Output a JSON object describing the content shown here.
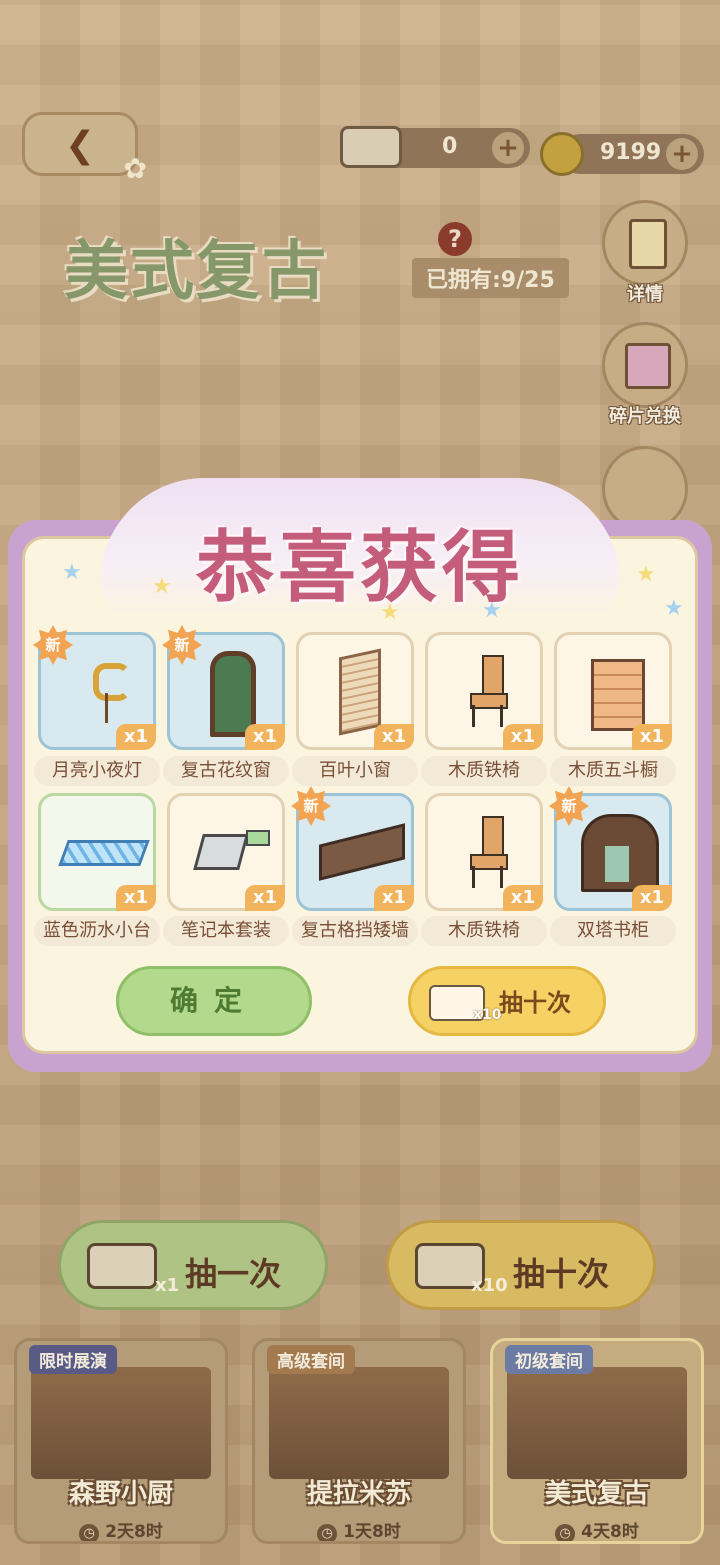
{
  "header": {
    "tickets": "0",
    "coins": "9199",
    "plus": "+"
  },
  "set": {
    "title": "美式复古",
    "help": "?",
    "owned": "已拥有:9/25"
  },
  "side": {
    "details": "详情",
    "exchange": "碎片兑换"
  },
  "modal": {
    "title": "恭喜获得",
    "new_badge": "新",
    "items": [
      {
        "name": "月亮小夜灯",
        "qty": "x1",
        "is_new": true
      },
      {
        "name": "复古花纹窗",
        "qty": "x1",
        "is_new": true
      },
      {
        "name": "百叶小窗",
        "qty": "x1",
        "is_new": false
      },
      {
        "name": "木质铁椅",
        "qty": "x1",
        "is_new": false
      },
      {
        "name": "木质五斗橱",
        "qty": "x1",
        "is_new": false
      },
      {
        "name": "蓝色沥水小台",
        "qty": "x1",
        "is_new": false
      },
      {
        "name": "笔记本套装",
        "qty": "x1",
        "is_new": false
      },
      {
        "name": "复古格挡矮墙",
        "qty": "x1",
        "is_new": true
      },
      {
        "name": "木质铁椅",
        "qty": "x1",
        "is_new": false
      },
      {
        "name": "双塔书柜",
        "qty": "x1",
        "is_new": true
      }
    ],
    "confirm": "确定",
    "draw_ten": "抽十次",
    "draw_ten_count": "x10"
  },
  "draw": {
    "one_label": "抽一次",
    "one_count": "x1",
    "ten_label": "抽十次",
    "ten_count": "x10"
  },
  "rooms": [
    {
      "tag": "限时展演",
      "name": "森野小厨",
      "time": "2天8时"
    },
    {
      "tag": "高级套间",
      "name": "提拉米苏",
      "time": "1天8时"
    },
    {
      "tag": "初级套间",
      "name": "美式复古",
      "time": "4天8时"
    }
  ],
  "colors": {
    "modal_title": "#c45d7b",
    "confirm": "#b3d98c",
    "draw_ten": "#f6d265",
    "new_badge": "#f3a452",
    "qty_badge": "#f1b35b"
  }
}
